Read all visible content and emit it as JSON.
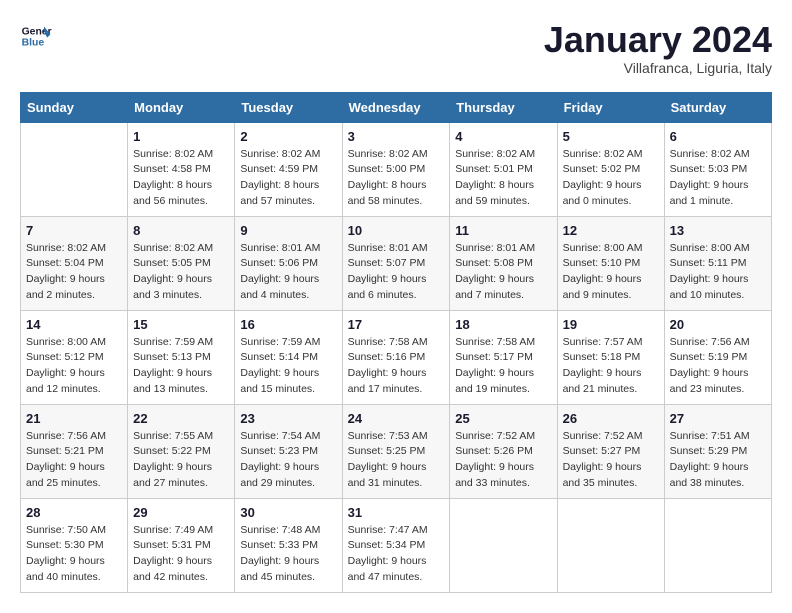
{
  "logo": {
    "line1": "General",
    "line2": "Blue"
  },
  "title": "January 2024",
  "subtitle": "Villafranca, Liguria, Italy",
  "headers": [
    "Sunday",
    "Monday",
    "Tuesday",
    "Wednesday",
    "Thursday",
    "Friday",
    "Saturday"
  ],
  "weeks": [
    [
      {
        "num": "",
        "sunrise": "",
        "sunset": "",
        "daylight": ""
      },
      {
        "num": "1",
        "sunrise": "Sunrise: 8:02 AM",
        "sunset": "Sunset: 4:58 PM",
        "daylight": "Daylight: 8 hours and 56 minutes."
      },
      {
        "num": "2",
        "sunrise": "Sunrise: 8:02 AM",
        "sunset": "Sunset: 4:59 PM",
        "daylight": "Daylight: 8 hours and 57 minutes."
      },
      {
        "num": "3",
        "sunrise": "Sunrise: 8:02 AM",
        "sunset": "Sunset: 5:00 PM",
        "daylight": "Daylight: 8 hours and 58 minutes."
      },
      {
        "num": "4",
        "sunrise": "Sunrise: 8:02 AM",
        "sunset": "Sunset: 5:01 PM",
        "daylight": "Daylight: 8 hours and 59 minutes."
      },
      {
        "num": "5",
        "sunrise": "Sunrise: 8:02 AM",
        "sunset": "Sunset: 5:02 PM",
        "daylight": "Daylight: 9 hours and 0 minutes."
      },
      {
        "num": "6",
        "sunrise": "Sunrise: 8:02 AM",
        "sunset": "Sunset: 5:03 PM",
        "daylight": "Daylight: 9 hours and 1 minute."
      }
    ],
    [
      {
        "num": "7",
        "sunrise": "Sunrise: 8:02 AM",
        "sunset": "Sunset: 5:04 PM",
        "daylight": "Daylight: 9 hours and 2 minutes."
      },
      {
        "num": "8",
        "sunrise": "Sunrise: 8:02 AM",
        "sunset": "Sunset: 5:05 PM",
        "daylight": "Daylight: 9 hours and 3 minutes."
      },
      {
        "num": "9",
        "sunrise": "Sunrise: 8:01 AM",
        "sunset": "Sunset: 5:06 PM",
        "daylight": "Daylight: 9 hours and 4 minutes."
      },
      {
        "num": "10",
        "sunrise": "Sunrise: 8:01 AM",
        "sunset": "Sunset: 5:07 PM",
        "daylight": "Daylight: 9 hours and 6 minutes."
      },
      {
        "num": "11",
        "sunrise": "Sunrise: 8:01 AM",
        "sunset": "Sunset: 5:08 PM",
        "daylight": "Daylight: 9 hours and 7 minutes."
      },
      {
        "num": "12",
        "sunrise": "Sunrise: 8:00 AM",
        "sunset": "Sunset: 5:10 PM",
        "daylight": "Daylight: 9 hours and 9 minutes."
      },
      {
        "num": "13",
        "sunrise": "Sunrise: 8:00 AM",
        "sunset": "Sunset: 5:11 PM",
        "daylight": "Daylight: 9 hours and 10 minutes."
      }
    ],
    [
      {
        "num": "14",
        "sunrise": "Sunrise: 8:00 AM",
        "sunset": "Sunset: 5:12 PM",
        "daylight": "Daylight: 9 hours and 12 minutes."
      },
      {
        "num": "15",
        "sunrise": "Sunrise: 7:59 AM",
        "sunset": "Sunset: 5:13 PM",
        "daylight": "Daylight: 9 hours and 13 minutes."
      },
      {
        "num": "16",
        "sunrise": "Sunrise: 7:59 AM",
        "sunset": "Sunset: 5:14 PM",
        "daylight": "Daylight: 9 hours and 15 minutes."
      },
      {
        "num": "17",
        "sunrise": "Sunrise: 7:58 AM",
        "sunset": "Sunset: 5:16 PM",
        "daylight": "Daylight: 9 hours and 17 minutes."
      },
      {
        "num": "18",
        "sunrise": "Sunrise: 7:58 AM",
        "sunset": "Sunset: 5:17 PM",
        "daylight": "Daylight: 9 hours and 19 minutes."
      },
      {
        "num": "19",
        "sunrise": "Sunrise: 7:57 AM",
        "sunset": "Sunset: 5:18 PM",
        "daylight": "Daylight: 9 hours and 21 minutes."
      },
      {
        "num": "20",
        "sunrise": "Sunrise: 7:56 AM",
        "sunset": "Sunset: 5:19 PM",
        "daylight": "Daylight: 9 hours and 23 minutes."
      }
    ],
    [
      {
        "num": "21",
        "sunrise": "Sunrise: 7:56 AM",
        "sunset": "Sunset: 5:21 PM",
        "daylight": "Daylight: 9 hours and 25 minutes."
      },
      {
        "num": "22",
        "sunrise": "Sunrise: 7:55 AM",
        "sunset": "Sunset: 5:22 PM",
        "daylight": "Daylight: 9 hours and 27 minutes."
      },
      {
        "num": "23",
        "sunrise": "Sunrise: 7:54 AM",
        "sunset": "Sunset: 5:23 PM",
        "daylight": "Daylight: 9 hours and 29 minutes."
      },
      {
        "num": "24",
        "sunrise": "Sunrise: 7:53 AM",
        "sunset": "Sunset: 5:25 PM",
        "daylight": "Daylight: 9 hours and 31 minutes."
      },
      {
        "num": "25",
        "sunrise": "Sunrise: 7:52 AM",
        "sunset": "Sunset: 5:26 PM",
        "daylight": "Daylight: 9 hours and 33 minutes."
      },
      {
        "num": "26",
        "sunrise": "Sunrise: 7:52 AM",
        "sunset": "Sunset: 5:27 PM",
        "daylight": "Daylight: 9 hours and 35 minutes."
      },
      {
        "num": "27",
        "sunrise": "Sunrise: 7:51 AM",
        "sunset": "Sunset: 5:29 PM",
        "daylight": "Daylight: 9 hours and 38 minutes."
      }
    ],
    [
      {
        "num": "28",
        "sunrise": "Sunrise: 7:50 AM",
        "sunset": "Sunset: 5:30 PM",
        "daylight": "Daylight: 9 hours and 40 minutes."
      },
      {
        "num": "29",
        "sunrise": "Sunrise: 7:49 AM",
        "sunset": "Sunset: 5:31 PM",
        "daylight": "Daylight: 9 hours and 42 minutes."
      },
      {
        "num": "30",
        "sunrise": "Sunrise: 7:48 AM",
        "sunset": "Sunset: 5:33 PM",
        "daylight": "Daylight: 9 hours and 45 minutes."
      },
      {
        "num": "31",
        "sunrise": "Sunrise: 7:47 AM",
        "sunset": "Sunset: 5:34 PM",
        "daylight": "Daylight: 9 hours and 47 minutes."
      },
      {
        "num": "",
        "sunrise": "",
        "sunset": "",
        "daylight": ""
      },
      {
        "num": "",
        "sunrise": "",
        "sunset": "",
        "daylight": ""
      },
      {
        "num": "",
        "sunrise": "",
        "sunset": "",
        "daylight": ""
      }
    ]
  ]
}
